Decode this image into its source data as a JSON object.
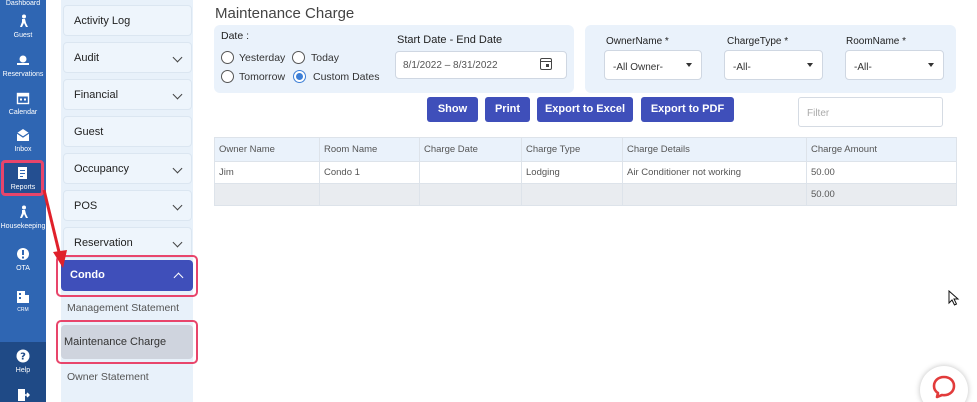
{
  "rail": {
    "items": [
      {
        "label": "Dashboard",
        "icon": "dashboard-icon"
      },
      {
        "label": "Guest",
        "icon": "guest-icon"
      },
      {
        "label": "Reservations",
        "icon": "reservations-icon"
      },
      {
        "label": "Calendar",
        "icon": "calendar-icon"
      },
      {
        "label": "Inbox",
        "icon": "inbox-icon"
      },
      {
        "label": "Reports",
        "icon": "reports-icon"
      },
      {
        "label": "Housekeeping",
        "icon": "housekeeping-icon"
      },
      {
        "label": "OTA",
        "icon": "ota-icon"
      },
      {
        "label": "CRM",
        "icon": "crm-icon"
      },
      {
        "label": "Help",
        "icon": "help-icon"
      },
      {
        "label": "",
        "icon": "logout-icon"
      }
    ]
  },
  "submenu": {
    "items": [
      "Activity Log",
      "Audit",
      "Financial",
      "Guest",
      "Occupancy",
      "POS",
      "Reservation"
    ],
    "active_group": "Condo",
    "sub_items": [
      "Management Statement",
      "Maintenance Charge",
      "Owner Statement"
    ]
  },
  "page": {
    "title": "Maintenance Charge",
    "date_label": "Date :",
    "radios": [
      "Yesterday",
      "Today",
      "Tomorrow",
      "Custom Dates"
    ],
    "range_label": "Start Date - End Date",
    "range_value": "8/1/2022 – 8/31/2022",
    "owner_label": "OwnerName *",
    "owner_value": "-All Owner-",
    "charge_type_label": "ChargeType *",
    "charge_type_value": "-All-",
    "room_label": "RoomName *",
    "room_value": "-All-",
    "buttons": {
      "show": "Show",
      "print": "Print",
      "excel": "Export to Excel",
      "pdf": "Export to PDF"
    },
    "filter_placeholder": "Filter"
  },
  "table": {
    "headers": [
      "Owner Name",
      "Room Name",
      "Charge Date",
      "Charge Type",
      "Charge Details",
      "Charge Amount"
    ],
    "row": [
      "Jim",
      "Condo 1",
      "",
      "Lodging",
      "Air Conditioner not working",
      "50.00"
    ],
    "total": "50.00"
  },
  "colors": {
    "rail": "#2f66b3",
    "primary": "#3f4fba",
    "highlight": "#e8456b",
    "panel": "#eaf2fb"
  }
}
